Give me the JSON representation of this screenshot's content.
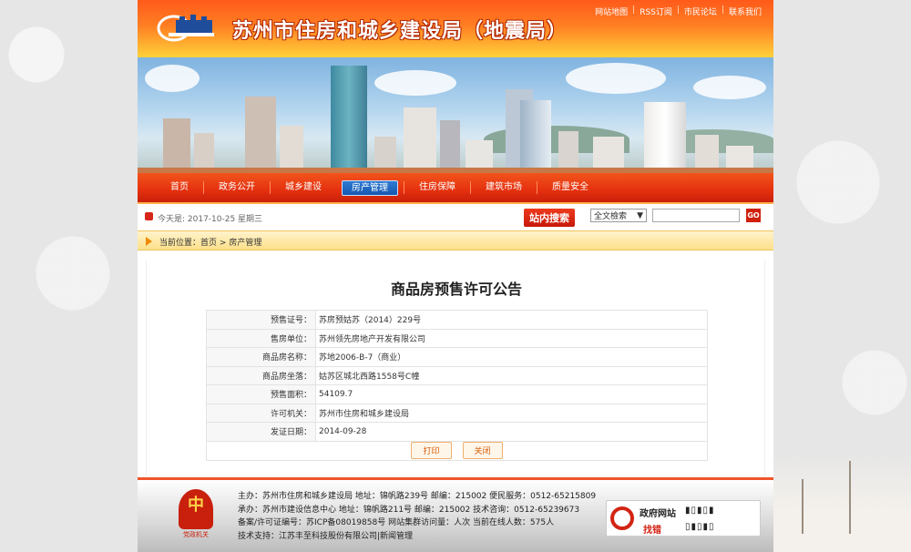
{
  "header": {
    "site_title": "苏州市住房和城乡建设局（地震局）",
    "top_links": [
      "网站地图",
      "RSS订阅",
      "市民论坛",
      "联系我们"
    ]
  },
  "nav": {
    "items": [
      {
        "label": "首页"
      },
      {
        "label": "政务公开"
      },
      {
        "label": "城乡建设"
      },
      {
        "label": "房产管理",
        "active": true
      },
      {
        "label": "住房保障"
      },
      {
        "label": "建筑市场"
      },
      {
        "label": "质量安全"
      }
    ]
  },
  "searchbar": {
    "date_text": "今天是: 2017-10-25 星期三",
    "search_label": "站内搜索",
    "select_value": "全文檢索",
    "go_label": "GO"
  },
  "breadcrumb": {
    "prefix": "当前位置：",
    "home": "首页",
    "sep": ">",
    "current": "房产管理"
  },
  "notice": {
    "title": "商品房预售许可公告",
    "rows": [
      {
        "key": "预售证号：",
        "value": "苏房预姑苏（2014）229号"
      },
      {
        "key": "售房单位：",
        "value": "苏州领先房地产开发有限公司"
      },
      {
        "key": "商品房名称：",
        "value": "苏地2006-B-7（商业）"
      },
      {
        "key": "商品房坐落：",
        "value": "姑苏区城北西路1558号C幢"
      },
      {
        "key": "预售面积：",
        "value": "54109.7"
      },
      {
        "key": "许可机关：",
        "value": "苏州市住房和城乡建设局"
      },
      {
        "key": "发证日期：",
        "value": "2014-09-28"
      }
    ],
    "print_button": "打印",
    "close_button": "关闭"
  },
  "footer": {
    "badge_caption": "党政机关",
    "lines": [
      "主办：苏州市住房和城乡建设局  地址：锦帆路239号  邮编：215002  便民服务：0512-65215809",
      "承办：苏州市建设信息中心  地址：锦帆路211号  邮编：215002  技术咨询：0512-65239673",
      "备案/许可证编号：苏ICP备08019858号  网站集群访问量：人次    当前在线人数：575人",
      "技术支持：江苏丰至科技股份有限公司|新闻管理"
    ],
    "gov_site_line1": "政府网站",
    "gov_site_line2": "找错"
  },
  "colors": {
    "header_red": "#ff5a1a",
    "nav_red": "#e4300f",
    "nav_active_blue": "#1558b0",
    "accent_orange": "#f08a00"
  }
}
